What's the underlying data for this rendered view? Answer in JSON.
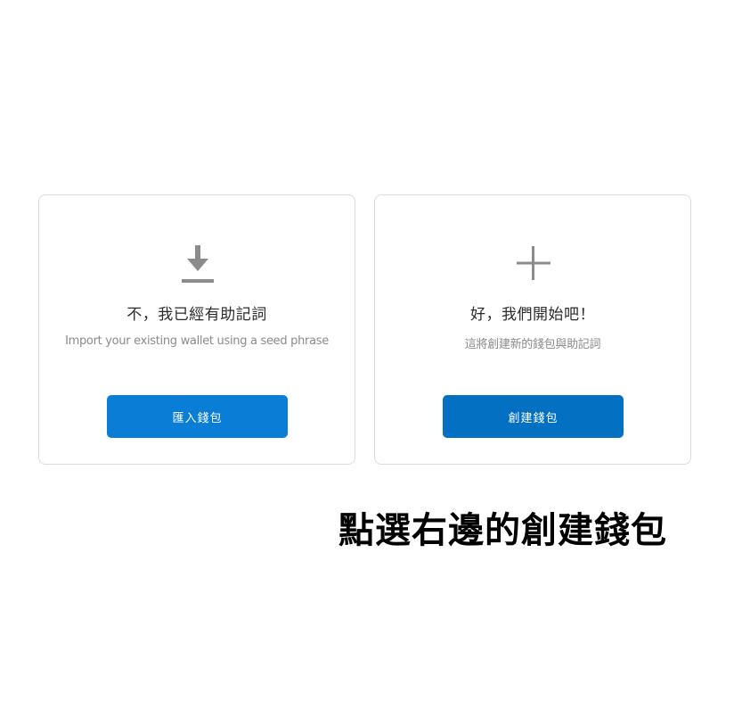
{
  "import_card": {
    "icon": "download-icon",
    "title": "不，我已經有助記詞",
    "subtitle": "Import your existing wallet using a seed phrase",
    "button_label": "匯入錢包"
  },
  "create_card": {
    "icon": "plus-icon",
    "title": "好，我們開始吧！",
    "subtitle": "這將創建新的錢包與助記詞",
    "button_label": "創建錢包"
  },
  "annotation": {
    "caption": "點選右邊的創建錢包"
  },
  "colors": {
    "button_blue": "#0376c9",
    "icon_gray": "#8c8c8c",
    "card_border": "#dcdcdc"
  }
}
